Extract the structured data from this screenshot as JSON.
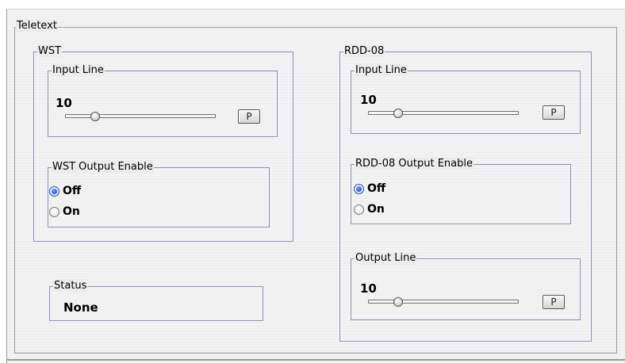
{
  "teletext": {
    "title": "Teletext",
    "wst": {
      "title": "WST",
      "input_line": {
        "title": "Input Line",
        "value": "10",
        "slider_fraction": 0.18,
        "button_label": "P"
      },
      "output_enable": {
        "title": "WST Output Enable",
        "options": [
          "Off",
          "On"
        ],
        "selected": "Off"
      }
    },
    "status": {
      "title": "Status",
      "value": "None"
    },
    "rdd08": {
      "title": "RDD-08",
      "input_line": {
        "title": "Input Line",
        "value": "10",
        "slider_fraction": 0.18,
        "button_label": "P"
      },
      "output_enable": {
        "title": "RDD-08 Output Enable",
        "options": [
          "Off",
          "On"
        ],
        "selected": "Off"
      },
      "output_line": {
        "title": "Output Line",
        "value": "10",
        "slider_fraction": 0.18,
        "button_label": "P"
      }
    }
  },
  "colors": {
    "radio_selected": "#1b50c8",
    "frame_border": "#8f8fb5",
    "panel_bg": "#ececec"
  }
}
